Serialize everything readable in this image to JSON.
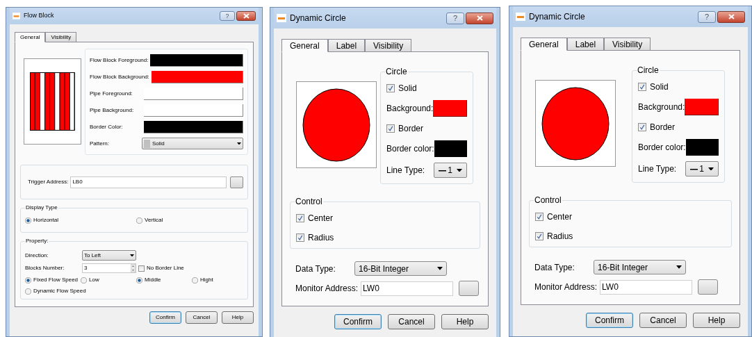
{
  "dialogs": [
    {
      "kind": "flow",
      "title": "Flow Block",
      "help": "?",
      "tabs": [
        {
          "label": "General",
          "selected": true
        },
        {
          "label": "Visibility",
          "selected": false
        }
      ],
      "colors": [
        {
          "label": "Flow Block Foreground:",
          "color": "#000000"
        },
        {
          "label": "Flow Block Background:",
          "color": "#ff0000"
        },
        {
          "label": "Pipe Foreground:",
          "color": "#ffffff"
        },
        {
          "label": "Pipe Background:",
          "color": "#ffffff"
        },
        {
          "label": "Border Color:",
          "color": "#000000"
        }
      ],
      "pattern": {
        "label": "Pattern:",
        "value": "Solid"
      },
      "trigger": {
        "label": "Trigger Address:",
        "value": "LB0"
      },
      "display_type": {
        "title": "Display Type",
        "options": [
          {
            "label": "Horizontal",
            "selected": true
          },
          {
            "label": "Vertical",
            "selected": false
          }
        ]
      },
      "property": {
        "title": "Property:",
        "direction": {
          "label": "Direction:",
          "value": "To Left"
        },
        "blocks": {
          "label": "Blocks Number:",
          "value": "3"
        },
        "no_border": {
          "label": "No Border Line",
          "checked": false
        },
        "speed_modes": [
          {
            "label": "Fixed Flow Speed",
            "selected": true
          },
          {
            "label": "Dynamic Flow Speed",
            "selected": false
          }
        ],
        "speeds": [
          {
            "label": "Low",
            "selected": false
          },
          {
            "label": "Middle",
            "selected": true
          },
          {
            "label": "Hight",
            "selected": false
          }
        ]
      },
      "buttons": [
        "Confirm",
        "Cancel",
        "Help"
      ]
    },
    {
      "kind": "circle",
      "title": "Dynamic Circle",
      "help": "?",
      "tabs": [
        {
          "label": "General",
          "selected": true
        },
        {
          "label": "Label",
          "selected": false
        },
        {
          "label": "Visibility",
          "selected": false
        }
      ],
      "circle": {
        "title": "Circle",
        "solid": {
          "label": "Solid",
          "checked": true
        },
        "background": {
          "label": "Background:",
          "color": "#ff0000"
        },
        "border": {
          "label": "Border",
          "checked": true
        },
        "border_color": {
          "label": "Border color:",
          "color": "#000000"
        },
        "line_type": {
          "label": "Line Type:",
          "value": "1"
        }
      },
      "control": {
        "title": "Control",
        "items": [
          {
            "label": "Center",
            "checked": true
          },
          {
            "label": "Radius",
            "checked": true
          }
        ]
      },
      "data_type": {
        "label": "Data Type:",
        "value": "16-Bit Integer"
      },
      "monitor": {
        "label": "Monitor Address:",
        "value": "LW0"
      },
      "buttons": [
        "Confirm",
        "Cancel",
        "Help"
      ]
    },
    {
      "kind": "circle",
      "title": "Dynamic Circle",
      "help": "?",
      "tabs": [
        {
          "label": "General",
          "selected": true
        },
        {
          "label": "Label",
          "selected": false
        },
        {
          "label": "Visibility",
          "selected": false
        }
      ],
      "circle": {
        "title": "Circle",
        "solid": {
          "label": "Solid",
          "checked": true
        },
        "background": {
          "label": "Background:",
          "color": "#ff0000"
        },
        "border": {
          "label": "Border",
          "checked": true
        },
        "border_color": {
          "label": "Border color:",
          "color": "#000000"
        },
        "line_type": {
          "label": "Line Type:",
          "value": "1"
        }
      },
      "control": {
        "title": "Control",
        "items": [
          {
            "label": "Center",
            "checked": true
          },
          {
            "label": "Radius",
            "checked": true
          }
        ]
      },
      "data_type": {
        "label": "Data Type:",
        "value": "16-Bit Integer"
      },
      "monitor": {
        "label": "Monitor Address:",
        "value": "LW0"
      },
      "buttons": [
        "Confirm",
        "Cancel",
        "Help"
      ]
    }
  ]
}
